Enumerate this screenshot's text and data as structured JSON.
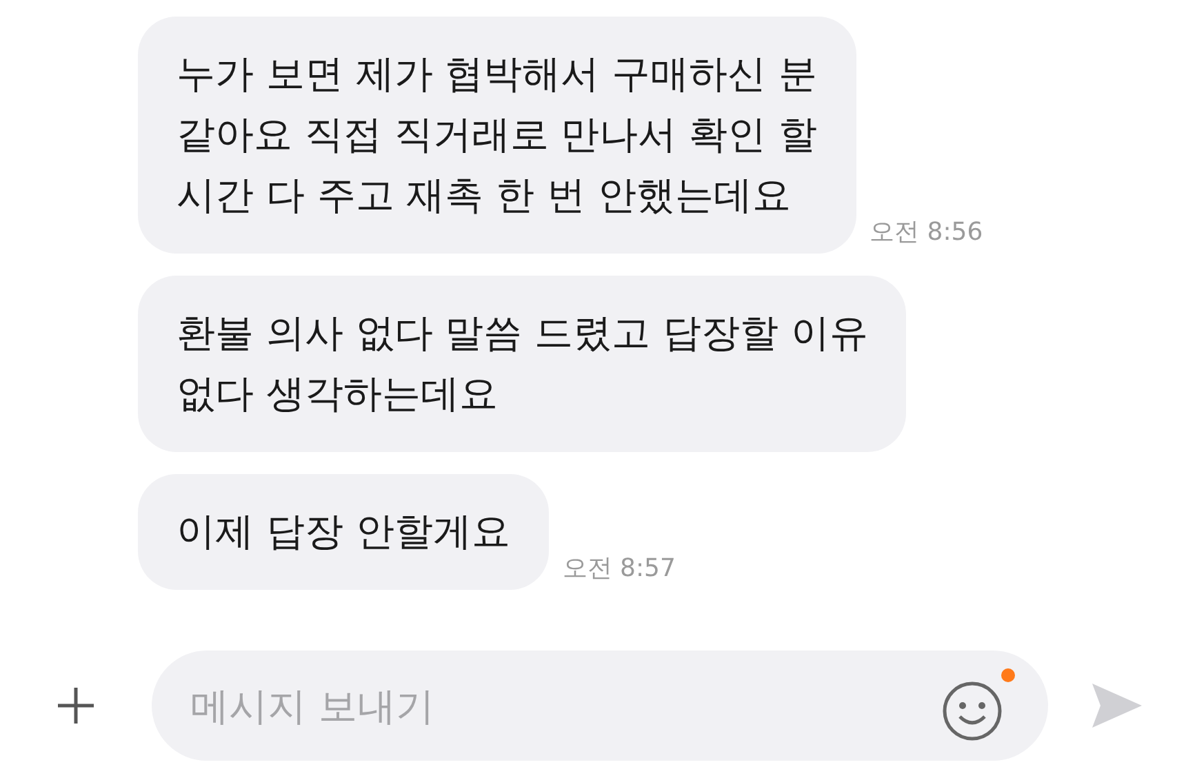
{
  "messages": [
    {
      "lines": [
        "누가 보면 제가 협박해서 구매하신 분",
        "같아요 직접 직거래로 만나서 확인 할",
        "시간 다 주고 재촉 한 번 안했는데요"
      ],
      "time": "오전 8:56"
    },
    {
      "lines": [
        "환불 의사 없다 말씀 드렸고 답장할 이유",
        "없다 생각하는데요"
      ]
    },
    {
      "lines": [
        "이제 답장 안할게요"
      ],
      "time": "오전 8:57"
    }
  ],
  "composer": {
    "placeholder": "메시지 보내기",
    "emoji_badge": true
  }
}
